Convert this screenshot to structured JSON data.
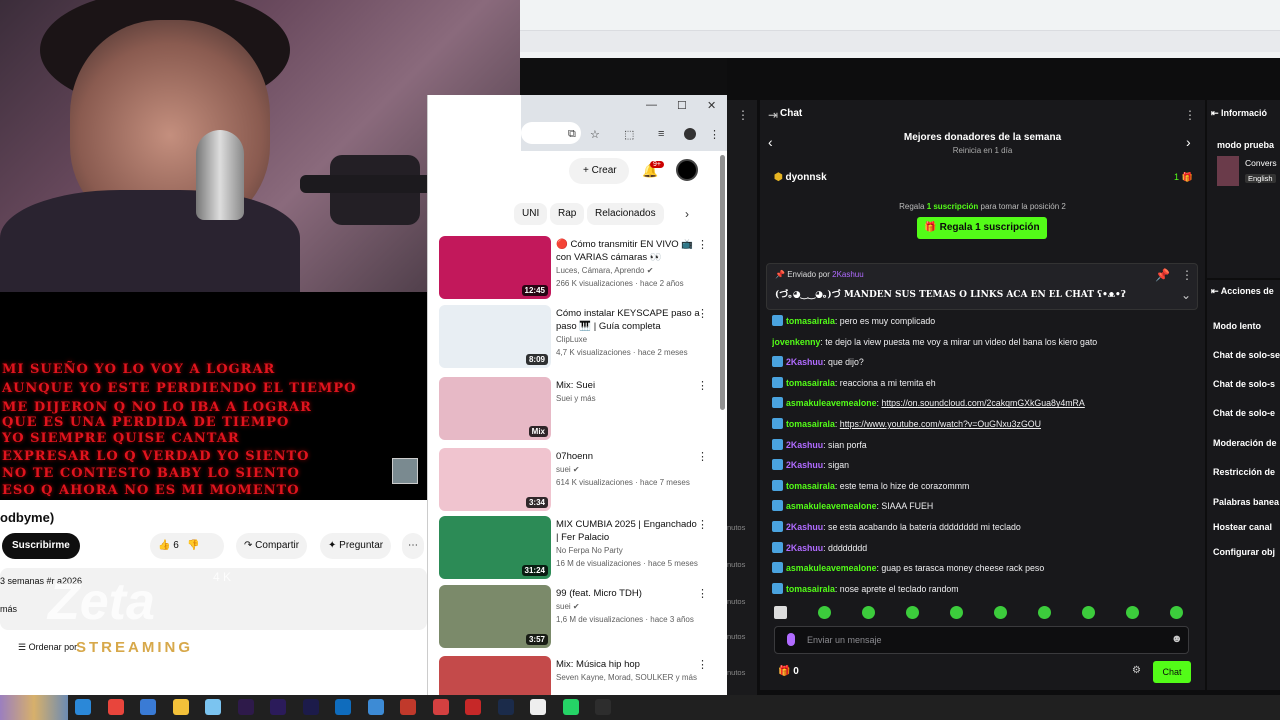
{
  "yt_video_lyrics": [
    "MI SUEÑO YO LO VOY A LOGRAR",
    "AUNQUE YO ESTE PERDIENDO EL TIEMPO",
    "ME DIJERON Q NO LO IBA A LOGRAR",
    "QUE ES UNA PERDIDA DE TIEMPO",
    "YO SIEMPRE QUISE CANTAR",
    "EXPRESAR LO Q VERDAD YO SIENTO",
    "NO TE CONTESTO BABY LO SIENTO",
    "ESO Q AHORA NO ES MI MOMENTO"
  ],
  "yt_left": {
    "title": "odbyme)",
    "subscribe": "Suscribirme",
    "likes": "6",
    "share": "Compartir",
    "ask": "Preguntar",
    "meta": "3 semanas  #r          a2026",
    "more": "más",
    "watermark": "Zeta",
    "watermark_sub": "4 K",
    "brand_text": "STREAMING",
    "order": "Ordenar por"
  },
  "yt_window": {
    "create": "Crear",
    "notif_count": "9+",
    "chips": [
      "UNI",
      "Rap",
      "Relacionados"
    ],
    "videos": [
      {
        "title": "🔴 Cómo transmitir EN VIVO 📺 con VARIAS cámaras 👀",
        "channel": "Luces, Cámara, Aprendo ✔",
        "views": "266 K visualizaciones · hace 2 años",
        "duration": "12:45",
        "color": "#c2185b"
      },
      {
        "title": "Cómo instalar KEYSCAPE paso a paso 🎹 | Guía completa",
        "channel": "ClipLuxe",
        "views": "4,7 K visualizaciones · hace 2 meses",
        "duration": "8:09",
        "color": "#e8eef3"
      },
      {
        "title": "Mix: Suei",
        "channel": "Suei y más",
        "views": "",
        "duration": "Mix",
        "color": "#e7b9c6"
      },
      {
        "title": "07hoenn",
        "channel": "suei ✔",
        "views": "614 K visualizaciones · hace 7 meses",
        "duration": "3:34",
        "color": "#f0c4cf"
      },
      {
        "title": "MIX CUMBIA 2025 | Enganchado | Fer Palacio",
        "channel": "No Ferpa No Party",
        "views": "16 M de visualizaciones · hace 5 meses",
        "duration": "31:24",
        "color": "#2c8b56"
      },
      {
        "title": "99 (feat. Micro TDH)",
        "channel": "suei ✔",
        "views": "1,6 M de visualizaciones · hace 3 años",
        "duration": "3:57",
        "color": "#7b8a6a"
      },
      {
        "title": "Mix: Música hip hop",
        "channel": "Seven Kayne, Morad, SOULKER y más",
        "views": "",
        "duration": "",
        "color": "#c44a4a"
      }
    ]
  },
  "chat": {
    "header": "Chat",
    "donors_title": "Mejores donadores de la semana",
    "donors_reset": "Reinicia en 1 día",
    "top_donor": "dyonnsk",
    "top_donor_count": "1",
    "gift_text_pre": "Regala",
    "gift_text_bold": "1 suscripción",
    "gift_text_post": "para tomar la posición 2",
    "gift_button": "Regala 1 suscripción",
    "pinned_by_label": "Enviado por",
    "pinned_by_user": "2Kashuu",
    "pinned_msg": "(づ｡◕‿‿◕｡)づ MANDEN SUS TEMAS O LINKS ACA EN EL CHAT ʕ•ᴥ•ʔ",
    "messages": [
      {
        "user": "tomasairala",
        "color": "#53fc18",
        "text": "pero es muy complicado",
        "icon": true
      },
      {
        "user": "jovenkenny",
        "color": "#53fc18",
        "text": "te dejo la view puesta me voy a mirar un video del bana los kiero gato",
        "icon": false
      },
      {
        "user": "2Kashuu",
        "color": "#b06bff",
        "text": "que dijo?",
        "icon": true
      },
      {
        "user": "tomasairala",
        "color": "#53fc18",
        "text": "reacciona a mi temita eh",
        "icon": true
      },
      {
        "user": "asmakuleavemealone",
        "color": "#53fc18",
        "text": "https://on.soundcloud.com/2cakqmGXkGua8y4mRA",
        "icon": true,
        "link": true
      },
      {
        "user": "tomasairala",
        "color": "#53fc18",
        "text": "https://www.youtube.com/watch?v=OuGNxu3zGOU",
        "icon": true,
        "link": true
      },
      {
        "user": "2Kashuu",
        "color": "#b06bff",
        "text": "sian porfa",
        "icon": true
      },
      {
        "user": "2Kashuu",
        "color": "#b06bff",
        "text": "sigan",
        "icon": true
      },
      {
        "user": "tomasairala",
        "color": "#53fc18",
        "text": "este tema lo hize de corazommm",
        "icon": true
      },
      {
        "user": "asmakuleavemealone",
        "color": "#53fc18",
        "text": "SIAAA FUEH",
        "icon": true
      },
      {
        "user": "2Kashuu",
        "color": "#b06bff",
        "text": "se esta acabando la batería dddddddd mi teclado",
        "icon": true
      },
      {
        "user": "2Kashuu",
        "color": "#b06bff",
        "text": "dddddddd",
        "icon": true
      },
      {
        "user": "asmakuleavemealone",
        "color": "#53fc18",
        "text": "guap es tarasca money cheese rack peso",
        "icon": true
      },
      {
        "user": "tomasairala",
        "color": "#53fc18",
        "text": "nose aprete el teclado random",
        "icon": true
      }
    ],
    "input_placeholder": "Enviar un mensaje",
    "gift_count": "0",
    "send_button": "Chat"
  },
  "right_panel": {
    "info_title": "Informació",
    "mode": "modo prueba",
    "conv": "Convers",
    "lang": "English",
    "actions_title": "Acciones de",
    "items": [
      "Modo lento",
      "Chat de solo-se",
      "Chat de solo-s",
      "Chat de solo-e",
      "Moderación de",
      "Restricción de",
      "Palabras banea",
      "Hostear canal",
      "Configurar obj"
    ]
  },
  "side_minutes": [
    "nutos",
    "nutos",
    "nutos",
    "nutos",
    "nutos"
  ],
  "taskbar_icons": [
    "windows-icon",
    "chrome-icon",
    "store-icon",
    "explorer-icon",
    "photos-icon",
    "media-encoder-icon",
    "premiere-icon",
    "after-effects-icon",
    "outlook-icon",
    "browser-icon",
    "app-icon",
    "screen-recorder-icon",
    "acrobat-icon",
    "lightroom-icon",
    "capcut-icon",
    "whatsapp-icon",
    "obs-icon"
  ],
  "colors": {
    "kick_green": "#53fc18",
    "chat_bg": "#18181b",
    "mod_purple": "#b06bff"
  }
}
